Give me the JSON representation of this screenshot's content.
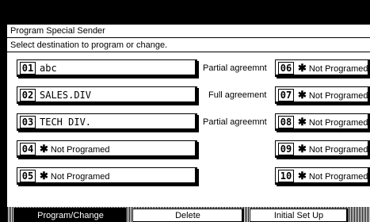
{
  "header": {
    "title": "Program Special Sender",
    "instruction": "Select destination to program or change."
  },
  "left_entries": [
    {
      "num": "01",
      "name": "abc",
      "match": "Partial agreemnt",
      "style": "mono"
    },
    {
      "num": "02",
      "name": "SALES.DIV",
      "match": "Full agreement",
      "style": "mono"
    },
    {
      "num": "03",
      "name": "TECH DIV.",
      "match": "Partial agreemnt",
      "style": "mono"
    },
    {
      "num": "04",
      "name": "Not Programed",
      "match": "",
      "style": "star"
    },
    {
      "num": "05",
      "name": "Not Programed",
      "match": "",
      "style": "star"
    }
  ],
  "right_entries": [
    {
      "num": "06",
      "name": "Not Programed"
    },
    {
      "num": "07",
      "name": "Not Programed"
    },
    {
      "num": "08",
      "name": "Not Programed"
    },
    {
      "num": "09",
      "name": "Not Programed"
    },
    {
      "num": "10",
      "name": "Not Programed"
    }
  ],
  "star_glyph": "✱",
  "tabs": {
    "program_change": "Program/Change",
    "delete": "Delete",
    "initial_setup": "Initial Set Up"
  }
}
